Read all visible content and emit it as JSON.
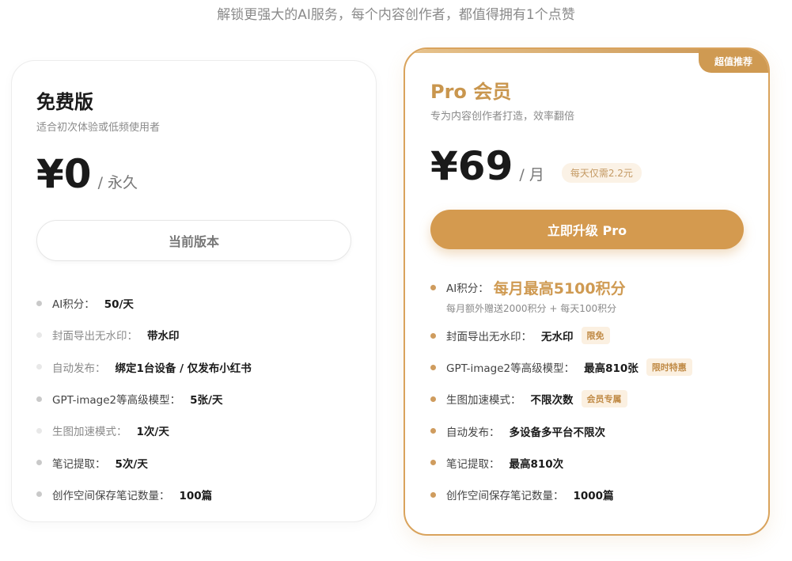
{
  "subtitle": "解锁更强大的AI服务，每个内容创作者，都值得拥有1个点赞",
  "free_plan": {
    "title": "免费版",
    "description": "适合初次体验或低频使用者",
    "price": "¥0",
    "period": "/ 永久",
    "button_label": "当前版本",
    "features": [
      {
        "label": "AI积分：",
        "value": "50/天",
        "muted": false
      },
      {
        "label": "封面导出无水印：",
        "value": "带水印",
        "muted": true
      },
      {
        "label": "自动发布：",
        "value": "绑定1台设备 / 仅发布小红书",
        "muted": true
      },
      {
        "label": "GPT-image2等高级模型：",
        "value": "5张/天",
        "muted": false
      },
      {
        "label": "生图加速模式：",
        "value": "1次/天",
        "muted": true
      },
      {
        "label": "笔记提取：",
        "value": "5次/天",
        "muted": false
      },
      {
        "label": "创作空间保存笔记数量：",
        "value": "100篇",
        "muted": false
      }
    ]
  },
  "pro_plan": {
    "badge": "超值推荐",
    "title": "Pro 会员",
    "description": "专为内容创作者打造，效率翻倍",
    "price": "¥69",
    "period": "/ 月",
    "daily_tag": "每天仅需2.2元",
    "button_label": "立即升级 Pro",
    "points": {
      "label": "AI积分：",
      "value": "每月最高5100积分",
      "note": "每月额外赠送2000积分 + 每天100积分"
    },
    "features": [
      {
        "label": "封面导出无水印：",
        "value": "无水印",
        "tag": "限免"
      },
      {
        "label": "GPT-image2等高级模型：",
        "value": "最高810张",
        "tag": "限时特惠"
      },
      {
        "label": "生图加速模式：",
        "value": "不限次数",
        "tag": "会员专属"
      },
      {
        "label": "自动发布：",
        "value": "多设备多平台不限次",
        "tag": ""
      },
      {
        "label": "笔记提取：",
        "value": "最高810次",
        "tag": ""
      },
      {
        "label": "创作空间保存笔记数量：",
        "value": "1000篇",
        "tag": ""
      }
    ]
  },
  "colors": {
    "accent": "#d49a4f",
    "accent_text": "#c9964e",
    "border_pro": "#d9a35c"
  }
}
